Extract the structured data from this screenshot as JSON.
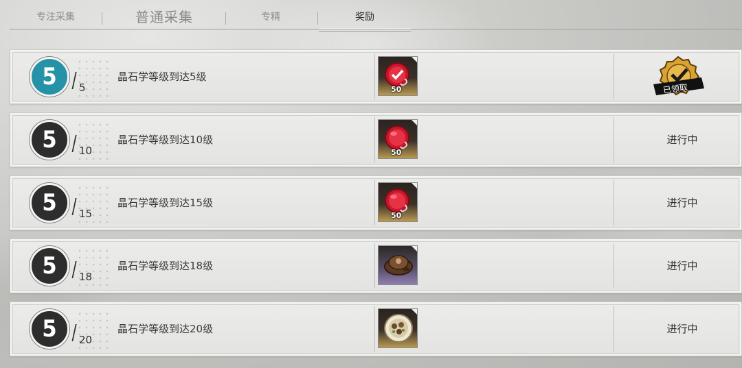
{
  "tabs": [
    {
      "label": "专注采集"
    },
    {
      "label": "普通采集"
    },
    {
      "label": "专精"
    },
    {
      "label": "奖励",
      "active": true
    }
  ],
  "rewards": [
    {
      "current": "5",
      "target": "5",
      "task": "晶石学等级到达5级",
      "item_qty": "50",
      "item_icon": "red-coin-check-icon",
      "status": "已领取",
      "completed": true
    },
    {
      "current": "5",
      "target": "10",
      "task": "晶石学等级到达10级",
      "item_qty": "50",
      "item_icon": "red-coin-icon",
      "status": "进行中",
      "completed": false
    },
    {
      "current": "5",
      "target": "15",
      "task": "晶石学等级到达15级",
      "item_qty": "50",
      "item_icon": "red-coin-icon",
      "status": "进行中",
      "completed": false
    },
    {
      "current": "5",
      "target": "18",
      "task": "晶石学等级到达18级",
      "item_qty": "",
      "item_icon": "mushroom-cap-icon",
      "status": "进行中",
      "completed": false
    },
    {
      "current": "5",
      "target": "20",
      "task": "晶石学等级到达20级",
      "item_qty": "",
      "item_icon": "food-plate-icon",
      "status": "进行中",
      "completed": false
    }
  ],
  "colors": {
    "accent_blue": "#2592a8",
    "badge_dark": "#2d2d2d",
    "claimed_gold": "#d9a233"
  }
}
